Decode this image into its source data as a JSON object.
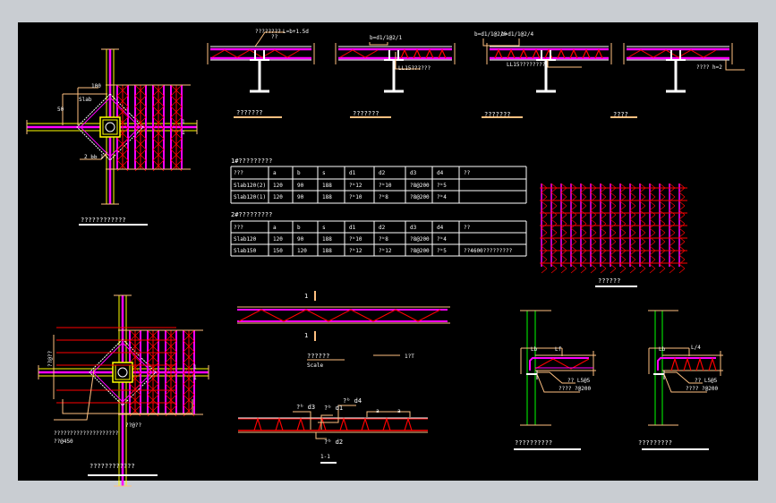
{
  "colors": {
    "background": "#000000",
    "frame": "#c9cdd2",
    "slab": "#ff00ff",
    "rebar": "#ff0000",
    "dimension": "#ffc080",
    "column": "#00ff00",
    "beam": "#ffff00",
    "text": "#ffffff"
  },
  "details_top": [
    {
      "title": "???????",
      "note": "????????",
      "note2": "L=b+1.5d",
      "note3": "??"
    },
    {
      "title": "???????",
      "note": "b=d1/1@2/1",
      "note2": "LL15??????"
    },
    {
      "title": "???????",
      "note": "b=d1/1@2/0",
      "note2": "b=d1/1@2/4",
      "note3": "LL15????????"
    },
    {
      "title": "????",
      "note": "????  h=2"
    }
  ],
  "plan_top": {
    "title": "????????????",
    "dim1": "100",
    "dim2": "50",
    "label1": "Slab",
    "label2": "2 ЬЬ 1",
    "mark1": "1",
    "mark2": "1"
  },
  "table1": {
    "title": "1#?????????",
    "headers": [
      "???",
      "a",
      "b",
      "s",
      "d1",
      "d2",
      "d3",
      "d4",
      "??"
    ],
    "rows": [
      [
        "Slab120(2)",
        "120",
        "90",
        "188",
        "?ᵇ12",
        "?ᵇ10",
        "?8@200",
        "?ᵇ5",
        ""
      ],
      [
        "Slab120(1)",
        "120",
        "90",
        "188",
        "?ᵇ10",
        "?ᵇ8",
        "?8@200",
        "?ᵇ4",
        ""
      ]
    ]
  },
  "table2": {
    "title": "2#?????????",
    "headers": [
      "???",
      "a",
      "b",
      "s",
      "d1",
      "d2",
      "d3",
      "d4",
      "??"
    ],
    "rows": [
      [
        "Slab120",
        "120",
        "90",
        "188",
        "?ᵇ10",
        "?ᵇ8",
        "?8@200",
        "?ᵇ4",
        ""
      ],
      [
        "Slab150",
        "150",
        "120",
        "188",
        "?ᵇ12",
        "?ᵇ12",
        "?8@200",
        "?ᵇ5",
        "??4600?????????"
      ]
    ]
  },
  "truss_grid": {
    "title": "??????"
  },
  "truss_elevation": {
    "section_mark": "1",
    "title": "??????",
    "subtitle": "Scale",
    "legend": "1?T"
  },
  "deck_section": {
    "label_d3": "?ᵇ d3",
    "label_d1": "?ᵇ d1",
    "label_d4": "?ᵇ d4",
    "label_d2": "?ᵇ d2",
    "dim_a": "a",
    "dim_b": "a",
    "title": "1-1"
  },
  "edge_details": [
    {
      "title": "??????????",
      "dim_lb": "Lb",
      "dim_lf": "Lf",
      "note1": "?? L5@5",
      "note2": "????  ?@200"
    },
    {
      "title": "?????????",
      "dim_lb": "Lb",
      "dim_lf": "L/4",
      "note1": "?? L5@5",
      "note2": "????  ?@200"
    }
  ],
  "plan_bottom": {
    "title": "????????????",
    "note1": "????????????????????",
    "note2": "??@450",
    "dim": "??@??",
    "side_dim": "??@??",
    "mark1": "1",
    "mark2": "1"
  }
}
